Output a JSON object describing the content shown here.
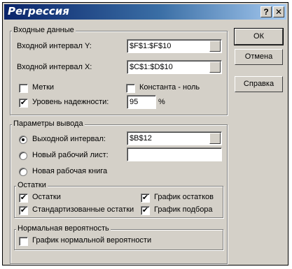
{
  "window": {
    "title": "Регрессия",
    "help_glyph": "?",
    "close_glyph": "✕"
  },
  "input_group": {
    "legend": "Входные данные",
    "y_label": "Входной интервал Y:",
    "y_value": "$F$1:$F$10",
    "x_label": "Входной интервал X:",
    "x_value": "$C$1:$D$10",
    "labels_label": "Метки",
    "labels_checked": false,
    "constant_zero_label": "Константа - ноль",
    "constant_zero_checked": false,
    "confidence_label": "Уровень надежности:",
    "confidence_checked": true,
    "confidence_value": "95",
    "percent": "%"
  },
  "output_group": {
    "legend": "Параметры вывода",
    "output_range_label": "Выходной интервал:",
    "output_range_value": "$B$12",
    "new_sheet_label": "Новый рабочий лист:",
    "new_sheet_value": "",
    "new_workbook_label": "Новая рабочая книга",
    "selected": "output_range"
  },
  "residuals_group": {
    "legend": "Остатки",
    "residuals_label": "Остатки",
    "residuals_checked": true,
    "std_residuals_label": "Стандартизованные остатки",
    "std_residuals_checked": true,
    "residual_plot_label": "График остатков",
    "residual_plot_checked": true,
    "line_fit_label": "График подбора",
    "line_fit_checked": true
  },
  "normal_group": {
    "legend": "Нормальная вероятность",
    "normal_plot_label": "График нормальной вероятности",
    "normal_plot_checked": false
  },
  "buttons": {
    "ok": "ОК",
    "cancel": "Отмена",
    "help": "Справка"
  }
}
